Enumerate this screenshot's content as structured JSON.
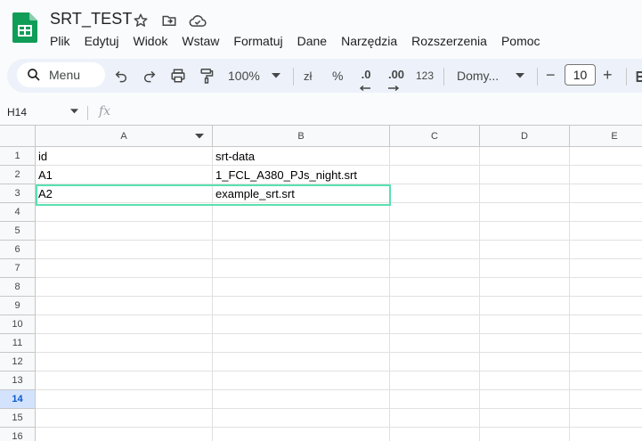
{
  "doc": {
    "title": "SRT_TEST",
    "icons": [
      "star-icon",
      "move-to-folder-icon",
      "cloud-saved-icon"
    ]
  },
  "menu": [
    "Plik",
    "Edytuj",
    "Widok",
    "Wstaw",
    "Formatuj",
    "Dane",
    "Narzędzia",
    "Rozszerzenia",
    "Pomoc"
  ],
  "toolbar": {
    "search_label": "Menu",
    "zoom": "100%",
    "currency": "zł",
    "percent": "%",
    "decrease_decimal": ".0",
    "increase_decimal": ".00",
    "number_format": "123",
    "font": "Domy...",
    "font_size": "10",
    "minus": "−",
    "plus": "+"
  },
  "formula_bar": {
    "name_box": "H14",
    "fx": "fx",
    "value": ""
  },
  "sheet": {
    "columns": [
      "A",
      "B",
      "C",
      "D",
      "E"
    ],
    "rows": [
      "1",
      "2",
      "3",
      "4",
      "5",
      "6",
      "7",
      "8",
      "9",
      "10",
      "11",
      "12",
      "13",
      "14",
      "15",
      "16"
    ],
    "cells": [
      [
        "id",
        "srt-data"
      ],
      [
        "A1",
        "1_FCL_A380_PJs_night.srt"
      ],
      [
        "A2",
        "example_srt.srt"
      ]
    ],
    "active_row": "14",
    "highlight_color": "#5be0b0"
  }
}
